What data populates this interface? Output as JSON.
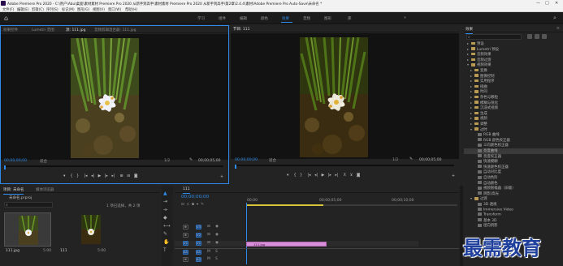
{
  "window": {
    "title": "Adobe Premiere Pro 2020 - C:\\用户\\Abu\\桌面\\素材素材 Premiere Pro 2020 从新手到高手\\素材素材 Premiere Pro 2020 从新手到高手\\第2章\\2.4.4\\素材\\Adobe Premiere Pro Auto-Save\\未命名 *",
    "minimize": "—",
    "maximize": "□",
    "close": "✕"
  },
  "menu": [
    "文件(F)",
    "编辑(E)",
    "剪辑(C)",
    "序列(S)",
    "标记(M)",
    "图形(G)",
    "视图(V)",
    "窗口(W)",
    "帮助(H)"
  ],
  "workspaces": {
    "items": [
      "学习",
      "组件",
      "编辑",
      "颜色",
      "效果",
      "音频",
      "图形",
      "库"
    ],
    "active": "效果",
    "more": "»"
  },
  "source_panel": {
    "tabs": [
      "效果控件",
      "Lumetri 范围",
      "源: 111.jpg",
      "音频剪辑混合器: 111.jpg"
    ],
    "timecode_left": "00;00;00;00",
    "fit": "适合",
    "fraction": "1/2",
    "timecode_right": "00;00;05;00"
  },
  "program_panel": {
    "tab": "节目: 111",
    "timecode_left": "00;00;00;00",
    "fit": "适合",
    "fraction": "1/2",
    "timecode_right": "00;00;05;00"
  },
  "project_panel": {
    "tabs": [
      "项目: 未命名",
      "媒体浏览器"
    ],
    "project_name": "未命名.prproj",
    "item_count": "1 项已选择，共 2 项",
    "search_placeholder": "",
    "items": [
      {
        "name": "111.jpg",
        "duration": "5:00"
      },
      {
        "name": "111",
        "duration": "5:00"
      }
    ]
  },
  "timeline": {
    "tab": "111",
    "timecode": "00;00;00;00",
    "ruler": [
      "00;00",
      "00;00;05;00",
      "00;00;10;00"
    ],
    "tracks": [
      {
        "src": "V1",
        "name": "V3"
      },
      {
        "src": "V1",
        "name": "V2"
      },
      {
        "src": "V1",
        "name": "V1"
      },
      {
        "src": "A1",
        "name": "A1"
      },
      {
        "src": "A1",
        "name": "A2"
      },
      {
        "src": "A1",
        "name": "A3"
      }
    ],
    "clip_label": "111.jpg"
  },
  "effects_panel": {
    "title": "效果",
    "search_placeholder": "",
    "tree": [
      {
        "label": "预设",
        "indent": 1,
        "kind": "folder",
        "open": false
      },
      {
        "label": "Lumetri 预设",
        "indent": 1,
        "kind": "folder",
        "open": false
      },
      {
        "label": "音频效果",
        "indent": 1,
        "kind": "folder",
        "open": false
      },
      {
        "label": "音频过渡",
        "indent": 1,
        "kind": "folder",
        "open": false
      },
      {
        "label": "视频效果",
        "indent": 1,
        "kind": "folder",
        "open": true
      },
      {
        "label": "变换",
        "indent": 2,
        "kind": "folder",
        "open": false
      },
      {
        "label": "图像控制",
        "indent": 2,
        "kind": "folder",
        "open": false
      },
      {
        "label": "实用程序",
        "indent": 2,
        "kind": "folder",
        "open": false
      },
      {
        "label": "扭曲",
        "indent": 2,
        "kind": "folder",
        "open": false
      },
      {
        "label": "时间",
        "indent": 2,
        "kind": "folder",
        "open": false
      },
      {
        "label": "杂色与颗粒",
        "indent": 2,
        "kind": "folder",
        "open": false
      },
      {
        "label": "模糊与锐化",
        "indent": 2,
        "kind": "folder",
        "open": false
      },
      {
        "label": "沉浸式视频",
        "indent": 2,
        "kind": "folder",
        "open": false
      },
      {
        "label": "生成",
        "indent": 2,
        "kind": "folder",
        "open": false
      },
      {
        "label": "视频",
        "indent": 2,
        "kind": "folder",
        "open": false
      },
      {
        "label": "调整",
        "indent": 2,
        "kind": "folder",
        "open": false
      },
      {
        "label": "过时",
        "indent": 2,
        "kind": "folder",
        "open": true
      },
      {
        "label": "RGB 曲线",
        "indent": 3,
        "kind": "fx",
        "open": false
      },
      {
        "label": "RGB 颜色校正器",
        "indent": 3,
        "kind": "fx",
        "open": false
      },
      {
        "label": "三向颜色校正器",
        "indent": 3,
        "kind": "fx",
        "open": false
      },
      {
        "label": "亮度曲线",
        "indent": 3,
        "kind": "fx",
        "open": false,
        "selected": true
      },
      {
        "label": "亮度校正器",
        "indent": 3,
        "kind": "fx",
        "open": false
      },
      {
        "label": "快速模糊",
        "indent": 3,
        "kind": "fx",
        "open": false
      },
      {
        "label": "快速颜色校正器",
        "indent": 3,
        "kind": "fx",
        "open": false
      },
      {
        "label": "自动对比度",
        "indent": 3,
        "kind": "fx",
        "open": false
      },
      {
        "label": "自动色阶",
        "indent": 3,
        "kind": "fx",
        "open": false
      },
      {
        "label": "自动颜色",
        "indent": 3,
        "kind": "fx",
        "open": false
      },
      {
        "label": "视频限幅器（旧版）",
        "indent": 3,
        "kind": "fx",
        "open": false
      },
      {
        "label": "阴影/高光",
        "indent": 3,
        "kind": "fx",
        "open": false
      },
      {
        "label": "过渡",
        "indent": 2,
        "kind": "folder",
        "open": true
      },
      {
        "label": "3D 透视",
        "indent": 3,
        "kind": "fx",
        "open": false
      },
      {
        "label": "Immersive Video",
        "indent": 3,
        "kind": "fx",
        "open": false
      },
      {
        "label": "Transform",
        "indent": 3,
        "kind": "fx",
        "open": false
      },
      {
        "label": "基本 3D",
        "indent": 3,
        "kind": "fx",
        "open": false
      },
      {
        "label": "径向阴影",
        "indent": 3,
        "kind": "fx",
        "open": false
      }
    ]
  },
  "watermark": "最需教育",
  "colors": {
    "accent": "#2d8ceb",
    "clip": "#d98ed9",
    "panel": "#232323",
    "viewer": "#121212"
  }
}
